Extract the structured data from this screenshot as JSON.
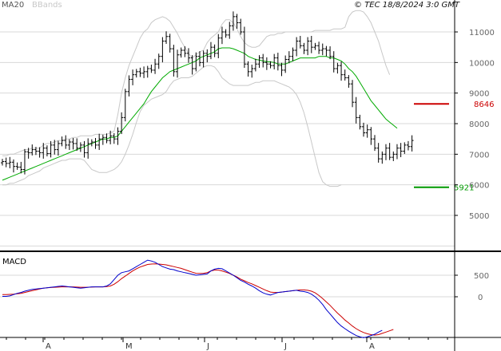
{
  "header": {
    "ma_label": "MA20",
    "bb_label": "BBands",
    "credit": "© TEC 18/8/2024 3:0 GMT"
  },
  "macd_label": "MACD",
  "colors": {
    "ma": "#00aa00",
    "bbands": "#c8c8c8",
    "price": "#000000",
    "macd": "#0000cc",
    "signal": "#cc0000",
    "resistance": "#cc0000",
    "support": "#009900",
    "grid": "#d8d8d8",
    "frame": "#000000"
  },
  "chart_data": [
    {
      "type": "ohlc",
      "x_tick_labels": [
        "A",
        "M",
        "J",
        "J",
        "A"
      ],
      "y_ticks": [
        5000,
        6000,
        7000,
        8000,
        9000,
        10000,
        11000
      ],
      "ylim": [
        4000,
        11700
      ],
      "levels": [
        {
          "name": "resistance",
          "value": 8646,
          "label": "8646"
        },
        {
          "name": "support",
          "value": 5921,
          "label": "5921"
        }
      ],
      "close": [
        6760,
        6700,
        6740,
        6600,
        6580,
        6500,
        7080,
        7050,
        7150,
        7100,
        7050,
        7200,
        7020,
        7300,
        7150,
        7350,
        7450,
        7300,
        7400,
        7350,
        7200,
        7300,
        7050,
        7350,
        7400,
        7300,
        7500,
        7550,
        7450,
        7600,
        7500,
        7750,
        8200,
        9050,
        9450,
        9600,
        9700,
        9650,
        9700,
        9800,
        9750,
        9950,
        10200,
        10700,
        10850,
        10450,
        9700,
        10250,
        10400,
        10300,
        10150,
        9800,
        10200,
        10000,
        10300,
        10200,
        10500,
        10300,
        10800,
        11000,
        10900,
        11200,
        11500,
        11300,
        11000,
        9950,
        9700,
        9800,
        9950,
        10150,
        10000,
        9950,
        9900,
        10150,
        9900,
        9750,
        10100,
        10200,
        10400,
        10700,
        10550,
        10400,
        10700,
        10500,
        10550,
        10400,
        10450,
        10400,
        10200,
        9800,
        9900,
        9600,
        9500,
        9300,
        8700,
        8200,
        7900,
        7700,
        7800,
        7500,
        7200,
        6850,
        7000,
        7200,
        6900,
        7000,
        7200,
        7100,
        7300,
        7250,
        7450
      ],
      "series": [
        {
          "name": "MA20",
          "values": [
            6150,
            6200,
            6250,
            6300,
            6350,
            6400,
            6450,
            6500,
            6550,
            6600,
            6650,
            6700,
            6750,
            6800,
            6850,
            6900,
            6950,
            7000,
            7050,
            7100,
            7150,
            7200,
            7250,
            7300,
            7350,
            7400,
            7450,
            7500,
            7500,
            7550,
            7550,
            7600,
            7750,
            7900,
            8050,
            8200,
            8350,
            8500,
            8650,
            8850,
            9050,
            9200,
            9350,
            9500,
            9600,
            9700,
            9750,
            9800,
            9850,
            9900,
            9950,
            10000,
            10050,
            10150,
            10200,
            10250,
            10300,
            10350,
            10450,
            10480,
            10480,
            10480,
            10450,
            10400,
            10350,
            10300,
            10200,
            10150,
            10100,
            10080,
            10050,
            10030,
            10020,
            10000,
            9950,
            9950,
            9950,
            10000,
            10050,
            10100,
            10150,
            10150,
            10150,
            10150,
            10150,
            10200,
            10200,
            10200,
            10150,
            10150,
            10100,
            10050,
            9950,
            9800,
            9700,
            9550,
            9350,
            9150,
            8950,
            8750,
            8600,
            8450,
            8300,
            8150,
            8050,
            7950,
            7850
          ],
          "color": "#00aa00"
        },
        {
          "name": "BBands upper",
          "values": [
            6950,
            6950,
            7000,
            7000,
            7050,
            7100,
            7150,
            7150,
            7200,
            7200,
            7200,
            7300,
            7350,
            7350,
            7400,
            7450,
            7450,
            7500,
            7500,
            7550,
            7550,
            7600,
            7600,
            7600,
            7600,
            7650,
            7650,
            7650,
            7650,
            7700,
            7750,
            8300,
            9000,
            9500,
            9900,
            10200,
            10500,
            10800,
            11000,
            11100,
            11300,
            11400,
            11450,
            11500,
            11450,
            11350,
            11150,
            10950,
            10700,
            10500,
            10300,
            10150,
            10250,
            10350,
            10400,
            10650,
            10800,
            10900,
            11000,
            11250,
            11400,
            11400,
            11300,
            11100,
            10850,
            10650,
            10550,
            10500,
            10500,
            10550,
            10700,
            10850,
            10900,
            10900,
            10950,
            10950,
            11000,
            11000,
            11000,
            11000,
            11000,
            11000,
            11000,
            11000,
            11050,
            11050,
            11050,
            11050,
            11050,
            11100,
            11100,
            11100,
            11150,
            11500,
            11650,
            11700,
            11700,
            11650,
            11500,
            11300,
            11000,
            10700,
            10300,
            9900,
            9600
          ],
          "color": "#c8c8c8"
        },
        {
          "name": "BBands lower",
          "values": [
            6000,
            6000,
            6050,
            6050,
            6100,
            6150,
            6200,
            6300,
            6350,
            6400,
            6450,
            6550,
            6600,
            6650,
            6700,
            6750,
            6800,
            6800,
            6850,
            6850,
            6850,
            6850,
            6800,
            6650,
            6500,
            6450,
            6400,
            6400,
            6400,
            6450,
            6500,
            6600,
            6750,
            7000,
            7300,
            7650,
            8050,
            8400,
            8600,
            8700,
            8800,
            8850,
            8900,
            8950,
            9050,
            9250,
            9400,
            9450,
            9500,
            9500,
            9500,
            9550,
            9650,
            9750,
            9850,
            9900,
            9900,
            9850,
            9700,
            9500,
            9400,
            9300,
            9250,
            9250,
            9250,
            9250,
            9250,
            9300,
            9350,
            9350,
            9400,
            9400,
            9400,
            9400,
            9350,
            9300,
            9250,
            9200,
            9100,
            8950,
            8700,
            8350,
            7900,
            7400,
            6900,
            6400,
            6100,
            6000,
            5950,
            5950,
            5950,
            6000
          ],
          "color": "#c8c8c8"
        }
      ]
    },
    {
      "type": "line",
      "title": "MACD",
      "y_ticks": [
        0,
        500
      ],
      "ylim": [
        -1200,
        1000
      ],
      "series": [
        {
          "name": "MACD",
          "values": [
            10,
            10,
            20,
            50,
            80,
            100,
            130,
            150,
            170,
            180,
            190,
            200,
            210,
            220,
            230,
            240,
            250,
            240,
            230,
            220,
            210,
            200,
            210,
            220,
            230,
            230,
            230,
            230,
            250,
            300,
            400,
            500,
            560,
            580,
            600,
            650,
            700,
            750,
            800,
            850,
            830,
            800,
            750,
            700,
            670,
            640,
            630,
            600,
            580,
            560,
            540,
            520,
            500,
            510,
            520,
            530,
            600,
            640,
            660,
            650,
            600,
            550,
            500,
            440,
            380,
            340,
            290,
            250,
            200,
            140,
            90,
            60,
            40,
            70,
            100,
            110,
            120,
            130,
            140,
            150,
            130,
            120,
            100,
            60,
            0,
            -80,
            -180,
            -300,
            -400,
            -500,
            -600,
            -680,
            -740,
            -800,
            -850,
            -900,
            -930,
            -950,
            -930,
            -900,
            -870,
            -820,
            -780
          ],
          "color": "#0000cc"
        },
        {
          "name": "Signal",
          "values": [
            50,
            50,
            55,
            60,
            70,
            80,
            100,
            120,
            140,
            160,
            180,
            200,
            210,
            215,
            220,
            225,
            230,
            230,
            230,
            230,
            225,
            220,
            220,
            220,
            225,
            230,
            230,
            230,
            235,
            250,
            290,
            350,
            420,
            480,
            540,
            600,
            650,
            690,
            720,
            750,
            760,
            765,
            760,
            750,
            740,
            720,
            700,
            680,
            660,
            630,
            600,
            570,
            545,
            540,
            545,
            560,
            600,
            620,
            620,
            600,
            570,
            540,
            500,
            460,
            410,
            370,
            330,
            300,
            260,
            220,
            180,
            140,
            110,
            100,
            100,
            110,
            120,
            130,
            140,
            150,
            160,
            160,
            150,
            130,
            90,
            30,
            -40,
            -120,
            -200,
            -290,
            -380,
            -460,
            -540,
            -610,
            -680,
            -740,
            -790,
            -830,
            -860,
            -880,
            -890,
            -880,
            -850,
            -820,
            -790,
            -760
          ],
          "color": "#cc0000"
        }
      ]
    }
  ]
}
